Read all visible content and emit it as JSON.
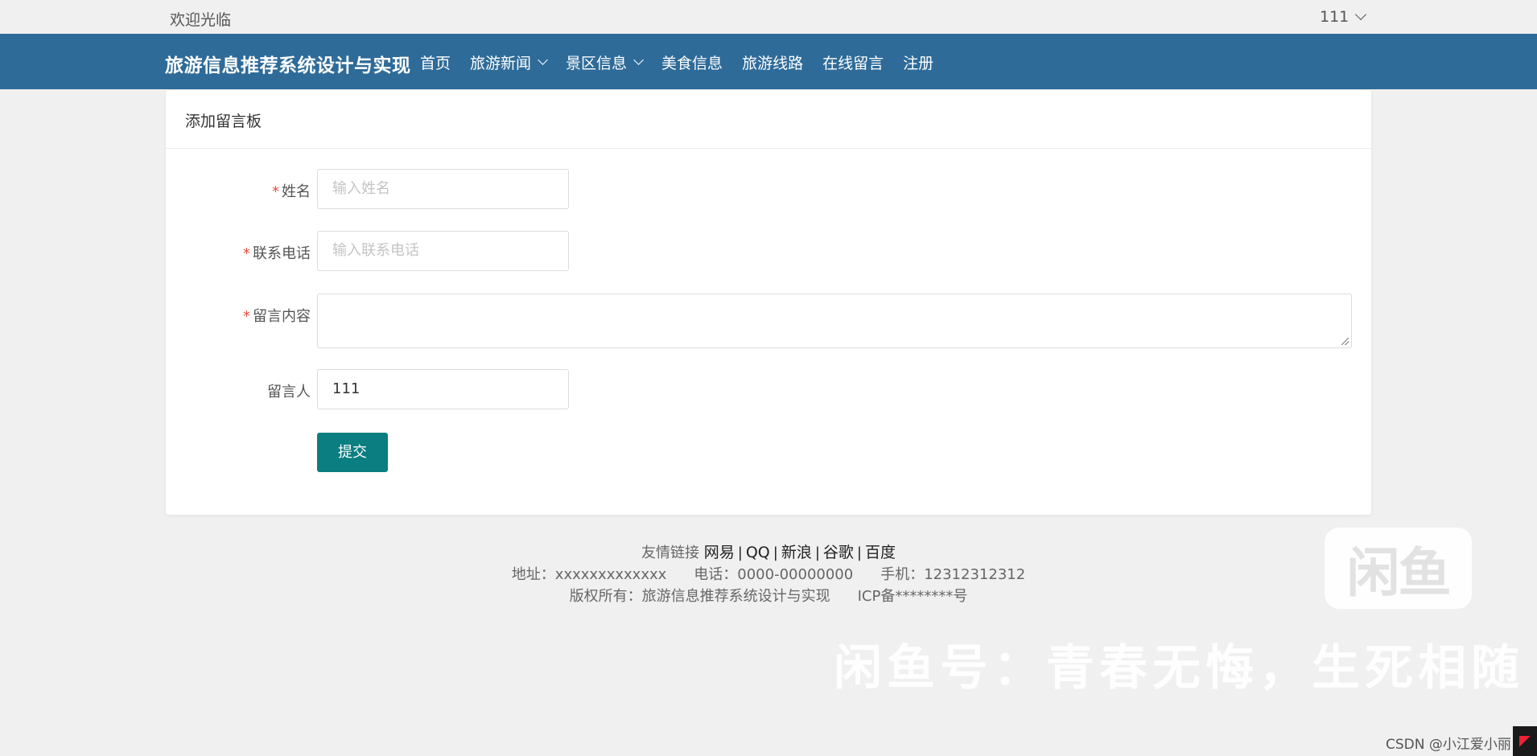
{
  "topbar": {
    "welcome": "欢迎光临",
    "user": "111"
  },
  "navbar": {
    "brand": "旅游信息推荐系统设计与实现",
    "menu": [
      {
        "label": "首页",
        "dropdown": false
      },
      {
        "label": "旅游新闻",
        "dropdown": true
      },
      {
        "label": "景区信息",
        "dropdown": true
      },
      {
        "label": "美食信息",
        "dropdown": false
      },
      {
        "label": "旅游线路",
        "dropdown": false
      },
      {
        "label": "在线留言",
        "dropdown": false
      },
      {
        "label": "注册",
        "dropdown": false
      }
    ]
  },
  "form": {
    "title": "添加留言板",
    "required_mark": "*",
    "name_label": "姓名",
    "name_placeholder": "输入姓名",
    "phone_label": "联系电话",
    "phone_placeholder": "输入联系电话",
    "content_label": "留言内容",
    "author_label": "留言人",
    "author_value": "111",
    "submit_label": "提交"
  },
  "footer": {
    "links_label": "友情链接",
    "links": [
      "网易",
      "QQ",
      "新浪",
      "谷歌",
      "百度"
    ],
    "link_separator": "|",
    "address": "地址：xxxxxxxxxxxxx",
    "phone": "电话：0000-00000000",
    "mobile": "手机：12312312312",
    "copyright": "版权所有：旅游信息推荐系统设计与实现",
    "icp": "ICP备********号"
  },
  "watermark": {
    "logo_text": "闲鱼",
    "text": "闲鱼号：青春无悔，生死相随",
    "csdn": "CSDN @小江爱小丽"
  },
  "colors": {
    "navbar": "#2e6b99",
    "submit": "#0a7e80",
    "required": "#e94b3c",
    "background": "#f0f0f0"
  }
}
